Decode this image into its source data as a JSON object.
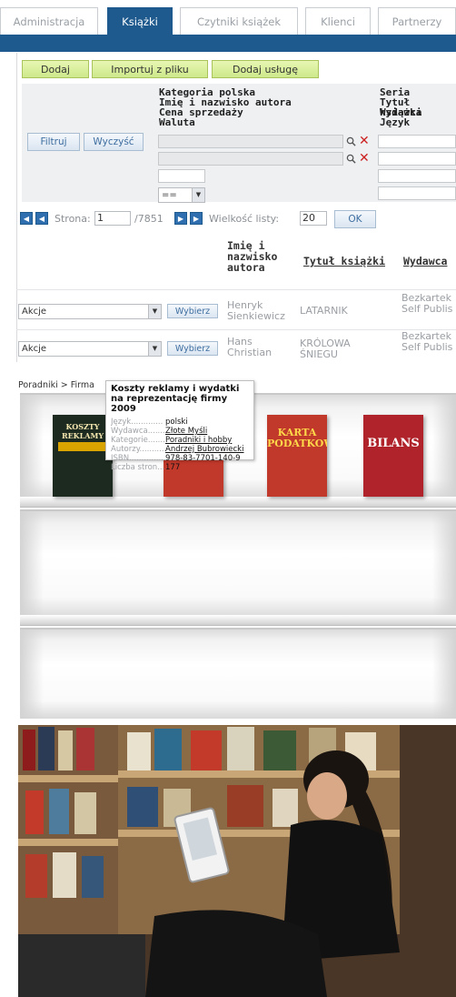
{
  "admin": {
    "tabs": [
      {
        "label": "Administracja",
        "active": false
      },
      {
        "label": "Książki",
        "active": true
      },
      {
        "label": "Czytniki książek",
        "active": false
      },
      {
        "label": "Klienci",
        "active": false
      },
      {
        "label": "Partnerzy",
        "active": false
      }
    ],
    "toolbar": {
      "add": "Dodaj",
      "import": "Importuj z pliku",
      "add_service": "Dodaj usługę"
    },
    "filter": {
      "filter_button": "Filtruj",
      "clear_button": "Wyczyść",
      "labels_left": [
        "Kategoria polska",
        "Imię i nazwisko autora",
        "Cena sprzedaży",
        "Waluta"
      ],
      "labels_right": [
        "Seria",
        "Tytuł książki",
        "Wydawca",
        "Język"
      ],
      "operator": "=="
    },
    "pager": {
      "page_label": "Strona:",
      "page": "1",
      "total": "/7851",
      "size_label": "Wielkość listy:",
      "size": "20",
      "ok": "OK"
    },
    "columns": [
      "Imię i nazwisko autora",
      "Tytuł książki",
      "Wydawca"
    ],
    "rows": [
      {
        "action": "Akcje",
        "choose": "Wybierz",
        "author": "Henryk Sienkiewicz",
        "title": "LATARNIK",
        "publisher": "Bezkartek Self Publis"
      },
      {
        "action": "Akcje",
        "choose": "Wybierz",
        "author": "Hans Christian",
        "title": "KRÓLOWA ŚNIEGU",
        "publisher": "Bezkartek Self Publis"
      }
    ],
    "colors": {
      "primary": "#1f5a8f",
      "button_green": "#cde98a",
      "clear_red": "#cc2222"
    }
  },
  "shelf": {
    "breadcrumb": "Poradniki > Firma",
    "tooltip": {
      "title": "Koszty reklamy i wydatki na reprezentację firmy 2009",
      "rows": [
        {
          "key": "Język.............",
          "value": "polski",
          "link": false
        },
        {
          "key": "Wydawca.........",
          "value": "Złote Myśli",
          "link": true
        },
        {
          "key": "Kategorie..........",
          "value": "Poradniki i hobby",
          "link": true
        },
        {
          "key": "Autorzy...........",
          "value": "Andrzej Bubrowiecki",
          "link": true
        },
        {
          "key": "ISBN...............",
          "value": "978-83-7701-140-9",
          "link": false
        },
        {
          "key": "Liczba stron....",
          "value": "177",
          "link": false
        }
      ]
    },
    "books": [
      {
        "title": "KOSZTY REKLAMY",
        "color": "#1d2a20"
      },
      {
        "title": "",
        "color": "#c0392b"
      },
      {
        "title": "KARTA PODATKOWA",
        "color": "#c0392b"
      },
      {
        "title": "BILANS",
        "color": "#b0232a"
      }
    ]
  }
}
